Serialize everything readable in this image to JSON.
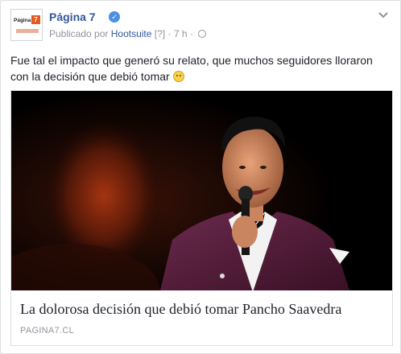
{
  "header": {
    "page_name": "Página 7",
    "published_by_prefix": "Publicado por",
    "publisher": "Hootsuite",
    "help_marker": "[?]",
    "separator": "·",
    "time": "7 h",
    "separator2": "·",
    "avatar_text": "Página",
    "avatar_badge": "7"
  },
  "post": {
    "text": "Fue tal el impacto que generó su relato, que muchos seguidores lloraron con la decisión que debió tomar"
  },
  "link": {
    "title": "La dolorosa decisión que debió tomar Pancho Saavedra",
    "domain": "PAGINA7.CL"
  },
  "icons": {
    "verified": "verified-badge-icon",
    "audience": "globe-icon",
    "menu": "chevron-down-icon",
    "emoji": "emoji-icon"
  },
  "colors": {
    "link_blue": "#365899",
    "meta_gray": "#90949c",
    "verified_blue": "#4a90e2",
    "suit_purple": "#5a1f3c"
  }
}
